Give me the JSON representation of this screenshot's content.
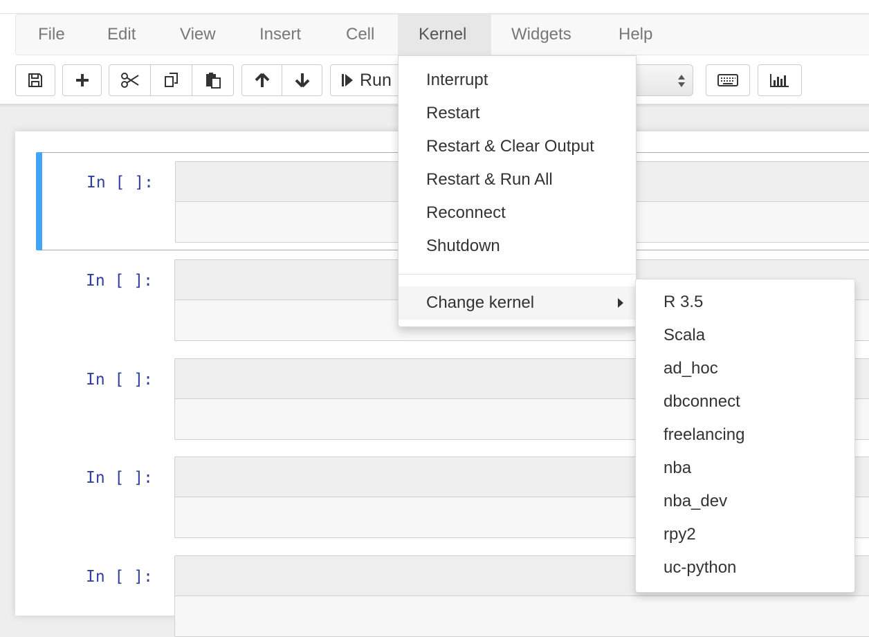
{
  "menubar": {
    "items": [
      "File",
      "Edit",
      "View",
      "Insert",
      "Cell",
      "Kernel",
      "Widgets",
      "Help"
    ],
    "active": "Kernel"
  },
  "toolbar": {
    "run_label": "Run",
    "icons": [
      "save-icon",
      "plus-icon",
      "scissors-icon",
      "copy-icon",
      "paste-icon",
      "arrow-up-icon",
      "arrow-down-icon",
      "step-forward-icon",
      "keyboard-icon",
      "bar-chart-icon"
    ]
  },
  "cells": [
    {
      "prompt": "In [ ]:",
      "selected": true
    },
    {
      "prompt": "In [ ]:",
      "selected": false
    },
    {
      "prompt": "In [ ]:",
      "selected": false
    },
    {
      "prompt": "In [ ]:",
      "selected": false
    },
    {
      "prompt": "In [ ]:",
      "selected": false
    }
  ],
  "kernel_menu": {
    "items": [
      "Interrupt",
      "Restart",
      "Restart & Clear Output",
      "Restart & Run All",
      "Reconnect",
      "Shutdown"
    ],
    "change_kernel": "Change kernel"
  },
  "change_kernel_submenu": {
    "items": [
      "R 3.5",
      "Scala",
      "ad_hoc",
      "dbconnect",
      "freelancing",
      "nba",
      "nba_dev",
      "rpy2",
      "uc-python"
    ]
  },
  "colors": {
    "selected_cell_bar": "#42a5f5",
    "prompt_text": "#303f9f",
    "menu_text": "#777777"
  }
}
